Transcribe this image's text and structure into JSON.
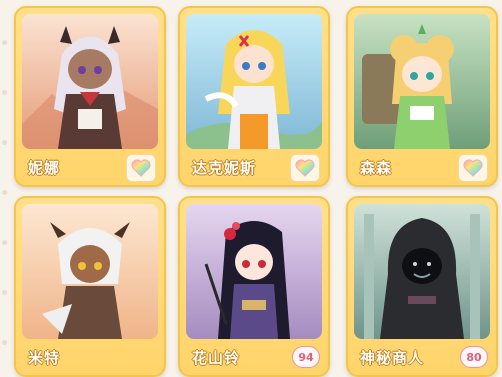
{
  "characters": [
    {
      "name": "妮娜",
      "affinity": "",
      "affinity_icon": "rainbow-heart-icon",
      "bg": "#f0b89a"
    },
    {
      "name": "达克妮斯",
      "affinity": "",
      "affinity_icon": "rainbow-heart-icon",
      "bg": "#9fd0e8"
    },
    {
      "name": "森森",
      "affinity": "",
      "affinity_icon": "rainbow-heart-icon",
      "bg": "#9fc9a4"
    },
    {
      "name": "米特",
      "affinity": "",
      "affinity_icon": "rainbow-heart-icon",
      "bg": "#f4c6a4"
    },
    {
      "name": "花山铃",
      "affinity": "94",
      "affinity_icon": "",
      "bg": "#c9a8d8"
    },
    {
      "name": "神秘商人",
      "affinity": "80",
      "affinity_icon": "",
      "bg": "#8eb0a6"
    }
  ]
}
